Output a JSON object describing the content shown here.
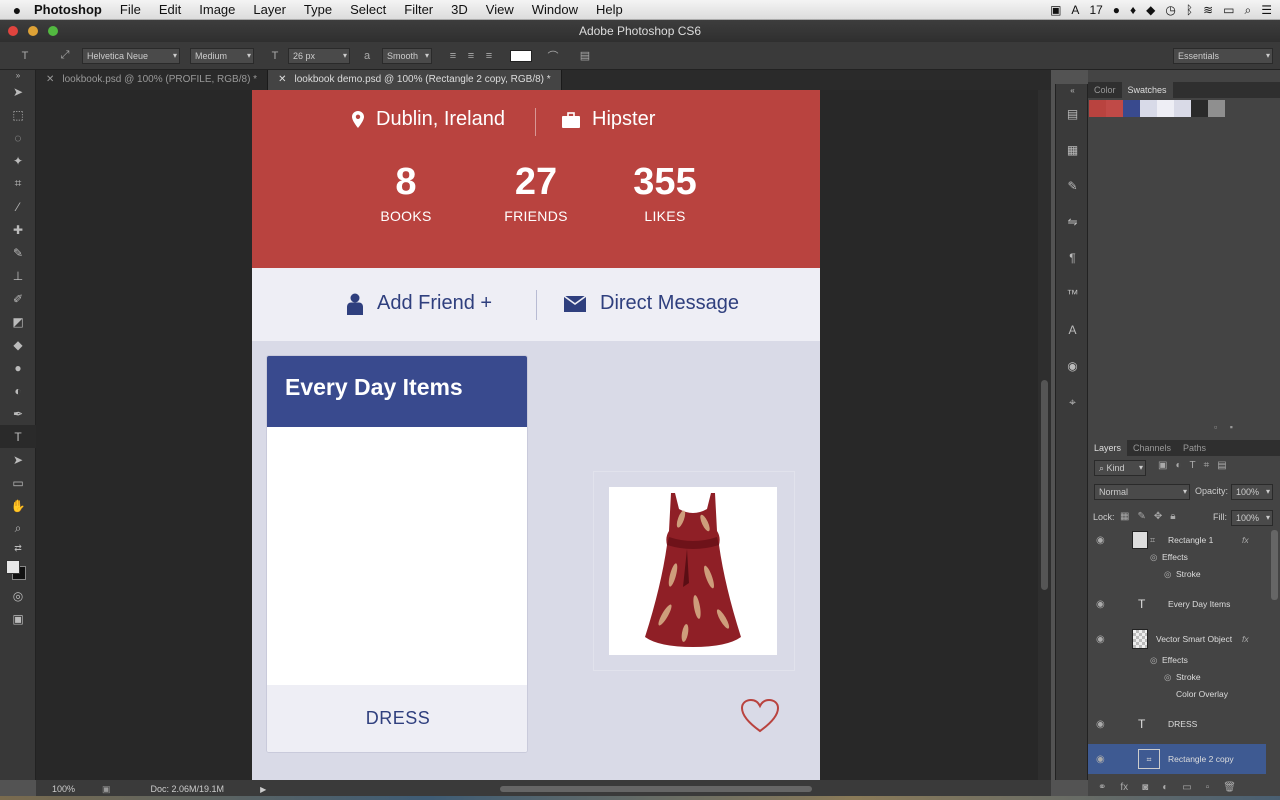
{
  "menubar": {
    "apple": "",
    "app_name": "Photoshop",
    "items": [
      "File",
      "Edit",
      "Image",
      "Layer",
      "Type",
      "Select",
      "Filter",
      "3D",
      "View",
      "Window",
      "Help"
    ],
    "status_text": "17"
  },
  "window": {
    "title": "Adobe Photoshop CS6"
  },
  "options": {
    "font_family": "Helvetica Neue",
    "font_style": "Medium",
    "font_size": "26 px",
    "antialias": "Smooth",
    "workspace": "Essentials",
    "text_color": "#ffffff"
  },
  "tabs": [
    {
      "label": "lookbook.psd @ 100% (PROFILE, RGB/8) *"
    },
    {
      "label": "lookbook demo.psd @ 100% (Rectangle 2 copy, RGB/8) *"
    }
  ],
  "design": {
    "location": "Dublin, Ireland",
    "style": "Hipster",
    "stats": [
      {
        "value": "8",
        "label": "BOOKS"
      },
      {
        "value": "27",
        "label": "FRIENDS"
      },
      {
        "value": "355",
        "label": "LIKES"
      }
    ],
    "add_friend": "Add Friend +",
    "direct_message": "Direct Message",
    "card_title": "Every Day Items",
    "card_footer": "DRESS",
    "colors": {
      "hero": "#b9433f",
      "card_header": "#394a8e",
      "accent_text": "#2f3f7e"
    }
  },
  "status": {
    "zoom": "100%",
    "doc": "Doc: 2.06M/19.1M"
  },
  "swatch_panel": {
    "tabs": [
      "Color",
      "Swatches"
    ],
    "swatches": [
      "#b9433f",
      "#c04a47",
      "#394a8e",
      "#d8dae8",
      "#eeeef5",
      "#d9dae7",
      "#2a2a2a",
      "#8f8f8f"
    ]
  },
  "layers_panel": {
    "tabs": [
      "Layers",
      "Channels",
      "Paths"
    ],
    "filter": "Kind",
    "blend_mode": "Normal",
    "opacity_label": "Opacity:",
    "opacity": "100%",
    "lock_label": "Lock:",
    "fill_label": "Fill:",
    "fill": "100%",
    "layers": [
      {
        "name": "Rectangle 1"
      },
      {
        "name": "Effects"
      },
      {
        "name": "Stroke"
      },
      {
        "name": "Every Day Items"
      },
      {
        "name": "Vector Smart Object"
      },
      {
        "name": "Effects"
      },
      {
        "name": "Stroke"
      },
      {
        "name": "Color Overlay"
      },
      {
        "name": "DRESS"
      },
      {
        "name": "Rectangle 2 copy"
      }
    ]
  }
}
